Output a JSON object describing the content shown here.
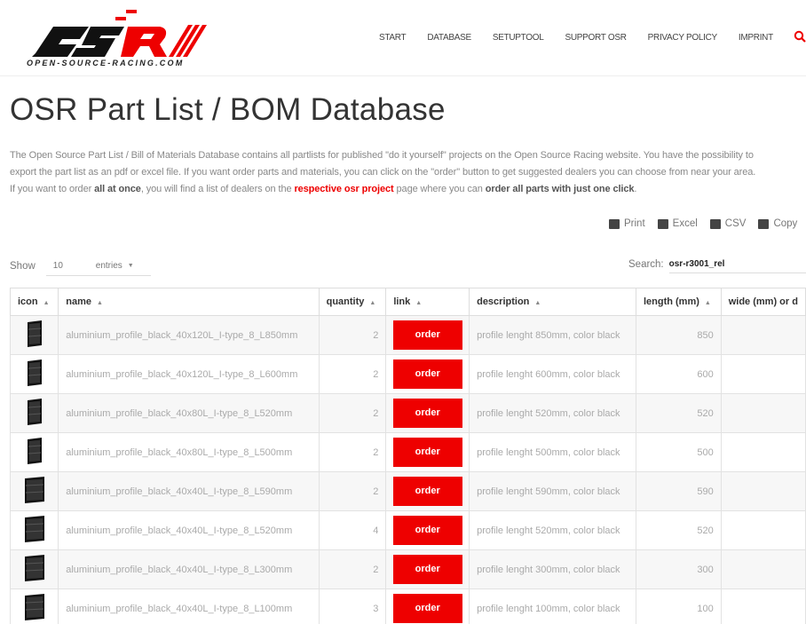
{
  "header": {
    "logo_text": "OSR",
    "logo_tagline": "OPEN-SOURCE-RACING.COM",
    "nav": [
      "START",
      "DATABASE",
      "SETUPTOOL",
      "SUPPORT OSR",
      "PRIVACY POLICY",
      "IMPRINT"
    ]
  },
  "page": {
    "title": "OSR Part List / BOM Database",
    "intro_1": "The Open Source Part List / Bill of Materials Database contains all partlists for published \"do it yourself\" projects on the Open Source Racing website. You have the possibility to",
    "intro_2": "export the part list as an pdf or excel file. If you want order parts and materials, you can click on the \"order\" button to get suggested dealers you can choose from near your area.",
    "intro_3a": "If you want to order ",
    "intro_3b": "all at once",
    "intro_3c": ", you will find a list of dealers on the ",
    "intro_3d": "respective osr project",
    "intro_3e": " page where you can ",
    "intro_3f": "order all parts with just one click",
    "intro_3g": "."
  },
  "export": {
    "print": "Print",
    "excel": "Excel",
    "csv": "CSV",
    "copy": "Copy"
  },
  "controls": {
    "show_label": "Show",
    "show_value": "10",
    "entries_label": "entries",
    "search_label": "Search:",
    "search_value": "osr-r3001_rel"
  },
  "table": {
    "headers": [
      "icon",
      "name",
      "quantity",
      "link",
      "description",
      "length (mm)",
      "wide (mm) or d"
    ],
    "order_label": "order",
    "rows": [
      {
        "name": "aluminium_profile_black_40x120L_I-type_8_L850mm",
        "quantity": "2",
        "description": "profile lenght 850mm, color black",
        "length": "850"
      },
      {
        "name": "aluminium_profile_black_40x120L_I-type_8_L600mm",
        "quantity": "2",
        "description": "profile lenght 600mm, color black",
        "length": "600"
      },
      {
        "name": "aluminium_profile_black_40x80L_I-type_8_L520mm",
        "quantity": "2",
        "description": "profile lenght 520mm, color black",
        "length": "520"
      },
      {
        "name": "aluminium_profile_black_40x80L_I-type_8_L500mm",
        "quantity": "2",
        "description": "profile lenght 500mm, color black",
        "length": "500"
      },
      {
        "name": "aluminium_profile_black_40x40L_I-type_8_L590mm",
        "quantity": "2",
        "description": "profile lenght 590mm, color black",
        "length": "590"
      },
      {
        "name": "aluminium_profile_black_40x40L_I-type_8_L520mm",
        "quantity": "4",
        "description": "profile lenght 520mm, color black",
        "length": "520"
      },
      {
        "name": "aluminium_profile_black_40x40L_I-type_8_L300mm",
        "quantity": "2",
        "description": "profile lenght 300mm, color black",
        "length": "300"
      },
      {
        "name": "aluminium_profile_black_40x40L_I-type_8_L100mm",
        "quantity": "3",
        "description": "profile lenght 100mm, color black",
        "length": "100"
      }
    ]
  },
  "colors": {
    "accent": "#e00000",
    "text": "#555555"
  }
}
